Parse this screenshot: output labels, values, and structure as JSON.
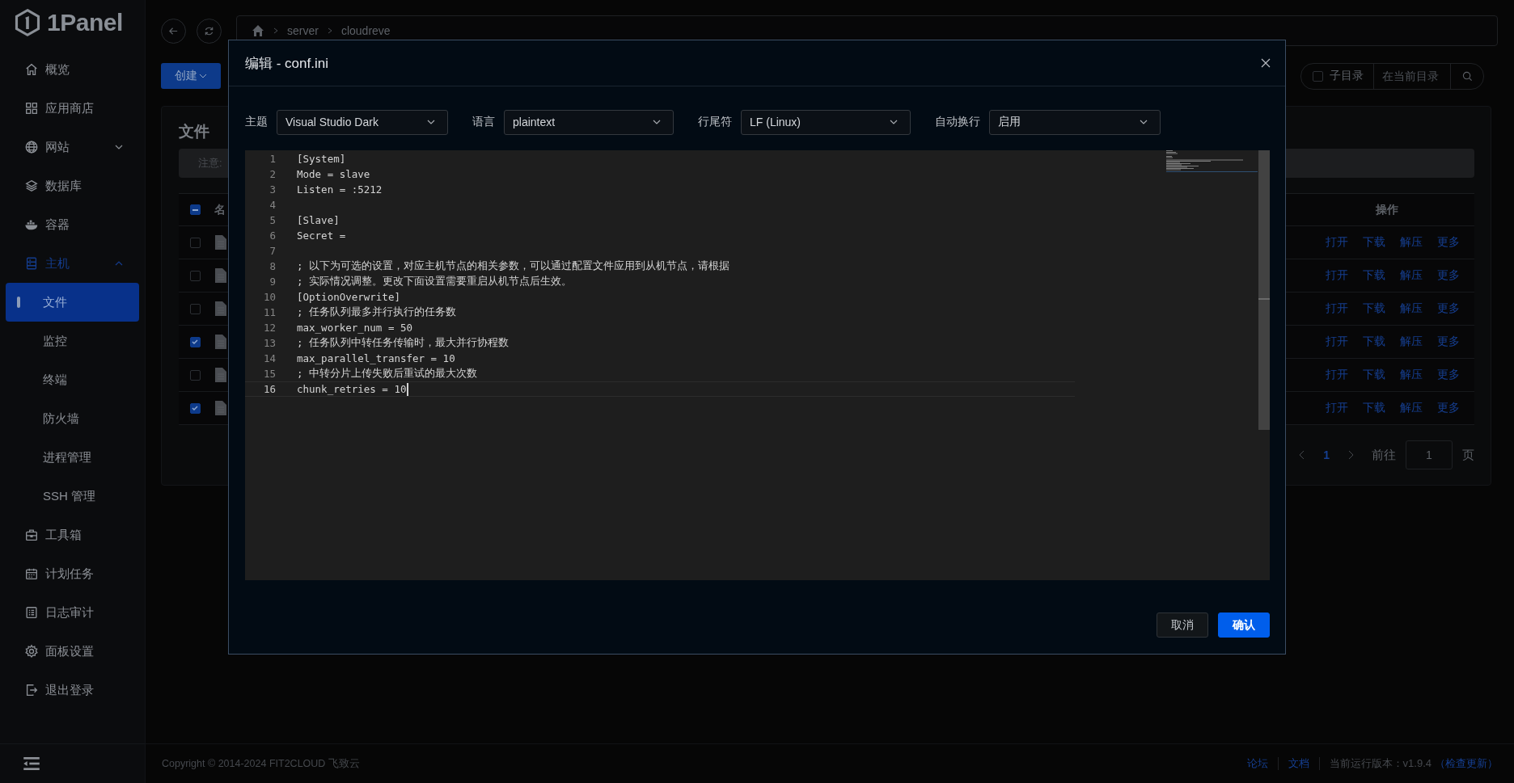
{
  "app": {
    "logo": "1Panel"
  },
  "sidebar": {
    "items": [
      {
        "label": "概览",
        "selected": false
      },
      {
        "label": "应用商店",
        "selected": false
      },
      {
        "label": "网站",
        "selected": false,
        "expanded": false
      },
      {
        "label": "数据库",
        "selected": false
      },
      {
        "label": "容器",
        "selected": false
      },
      {
        "label": "主机",
        "selected": false,
        "expanded": true,
        "children": [
          {
            "label": "文件",
            "selected": true
          },
          {
            "label": "监控",
            "selected": false
          },
          {
            "label": "终端",
            "selected": false
          },
          {
            "label": "防火墙",
            "selected": false
          },
          {
            "label": "进程管理",
            "selected": false
          },
          {
            "label": "SSH 管理",
            "selected": false
          }
        ]
      },
      {
        "label": "工具箱",
        "selected": false
      },
      {
        "label": "计划任务",
        "selected": false
      },
      {
        "label": "日志审计",
        "selected": false
      },
      {
        "label": "面板设置",
        "selected": false
      },
      {
        "label": "退出登录",
        "selected": false
      }
    ]
  },
  "breadcrumb": [
    "server",
    "cloudreve"
  ],
  "create_button": "创建",
  "search": {
    "subdir_label": "子目录",
    "subdir_checked": false,
    "placeholder": "在当前目录"
  },
  "files": {
    "title": "文件",
    "notice": "注意:",
    "columns": [
      "名",
      "操作"
    ],
    "select_all": {
      "indeterminate": true
    },
    "rows": [
      {
        "checked": false,
        "actions": [
          "打开",
          "下载",
          "解压",
          "更多"
        ]
      },
      {
        "checked": false,
        "actions": [
          "打开",
          "下载",
          "解压",
          "更多"
        ]
      },
      {
        "checked": false,
        "actions": [
          "打开",
          "下载",
          "解压",
          "更多"
        ]
      },
      {
        "checked": true,
        "actions": [
          "打开",
          "下载",
          "解压",
          "更多"
        ]
      },
      {
        "checked": false,
        "actions": [
          "打开",
          "下载",
          "解压",
          "更多"
        ]
      },
      {
        "checked": true,
        "actions": [
          "打开",
          "下载",
          "解压",
          "更多"
        ]
      }
    ],
    "pagination": {
      "pages": [
        {
          "label": "1",
          "selected": true
        }
      ],
      "goto_label": "前往",
      "goto_value": "1",
      "suffix": "页"
    }
  },
  "footer": {
    "copyright": "Copyright © 2014-2024 FIT2CLOUD 飞致云",
    "links": [
      "论坛",
      "文档"
    ],
    "version": "当前运行版本：v1.9.4",
    "check_update": "（检查更新）"
  },
  "dialog": {
    "title": "编辑 - conf.ini",
    "options": [
      {
        "label": "主题",
        "value": "Visual Studio Dark"
      },
      {
        "label": "语言",
        "value": "plaintext"
      },
      {
        "label": "行尾符",
        "value": "LF (Linux)"
      },
      {
        "label": "自动换行",
        "value": "启用"
      }
    ],
    "lines": [
      {
        "number": "1",
        "text": "[System]",
        "current": false
      },
      {
        "number": "2",
        "text": "Mode = slave",
        "current": false
      },
      {
        "number": "3",
        "text": "Listen = :5212",
        "current": false
      },
      {
        "number": "4",
        "current": false
      },
      {
        "number": "5",
        "text": "[Slave]",
        "current": false
      },
      {
        "number": "6",
        "text": "Secret =",
        "current": false
      },
      {
        "number": "7",
        "current": false
      },
      {
        "number": "8",
        "text": "; 以下为可选的设置，对应主机节点的相关参数，可以通过配置文件应用到从机节点，请根据",
        "current": false
      },
      {
        "number": "9",
        "text": "; 实际情况调整。更改下面设置需要重启从机节点后生效。",
        "current": false
      },
      {
        "number": "10",
        "text": "[OptionOverwrite]",
        "current": false
      },
      {
        "number": "11",
        "text": "; 任务队列最多并行执行的任务数",
        "current": false
      },
      {
        "number": "12",
        "text": "max_worker_num = 50",
        "current": false
      },
      {
        "number": "13",
        "text": "; 任务队列中转任务传输时，最大并行协程数",
        "current": false
      },
      {
        "number": "14",
        "text": "max_parallel_transfer = 10",
        "current": false
      },
      {
        "number": "15",
        "text": "; 中转分片上传失败后重试的最大次数",
        "current": false
      },
      {
        "number": "16",
        "text": "chunk_retries = 10",
        "current": true
      }
    ],
    "buttons": [
      {
        "kind": "secondary",
        "label": "取消"
      },
      {
        "kind": "primary",
        "label": "确认"
      }
    ]
  }
}
